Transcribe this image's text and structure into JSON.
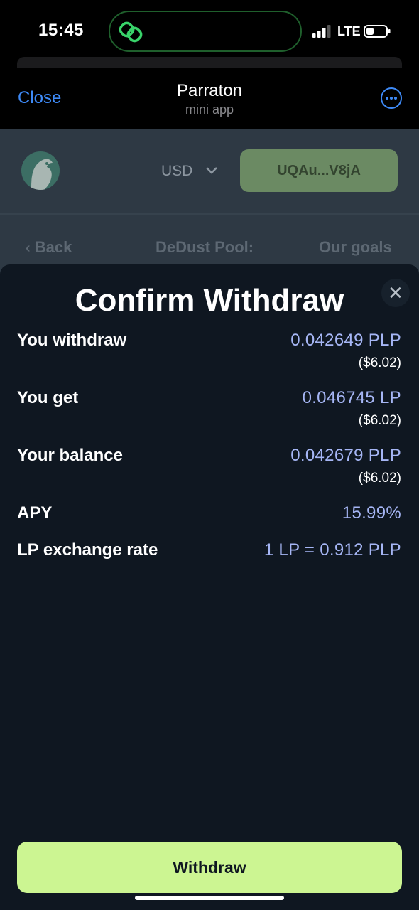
{
  "status_bar": {
    "time": "15:45",
    "network": "LTE"
  },
  "header": {
    "close_label": "Close",
    "title": "Parraton",
    "subtitle": "mini app",
    "more_icon": "ellipsis-icon"
  },
  "app": {
    "currency": "USD",
    "wallet_address": "UQAu...V8jA",
    "nav": {
      "back": "Back",
      "pool_title": "DeDust Pool:",
      "goals": "Our goals"
    }
  },
  "modal": {
    "title": "Confirm Withdraw",
    "close_icon": "close-icon",
    "rows": [
      {
        "label": "You withdraw",
        "value": "0.042649 PLP",
        "sub": "($6.02)"
      },
      {
        "label": "You get",
        "value": "0.046745 LP",
        "sub": "($6.02)"
      },
      {
        "label": "Your balance",
        "value": "0.042679 PLP",
        "sub": "($6.02)"
      },
      {
        "label": "APY",
        "value": "15.99%"
      },
      {
        "label": "LP exchange rate",
        "value": "1 LP = 0.912 PLP"
      }
    ],
    "withdraw_label": "Withdraw"
  },
  "colors": {
    "accent_link": "#3e8af7",
    "value_text": "#a6b6f5",
    "primary_button": "#ccf592",
    "modal_bg": "#0f1721"
  }
}
